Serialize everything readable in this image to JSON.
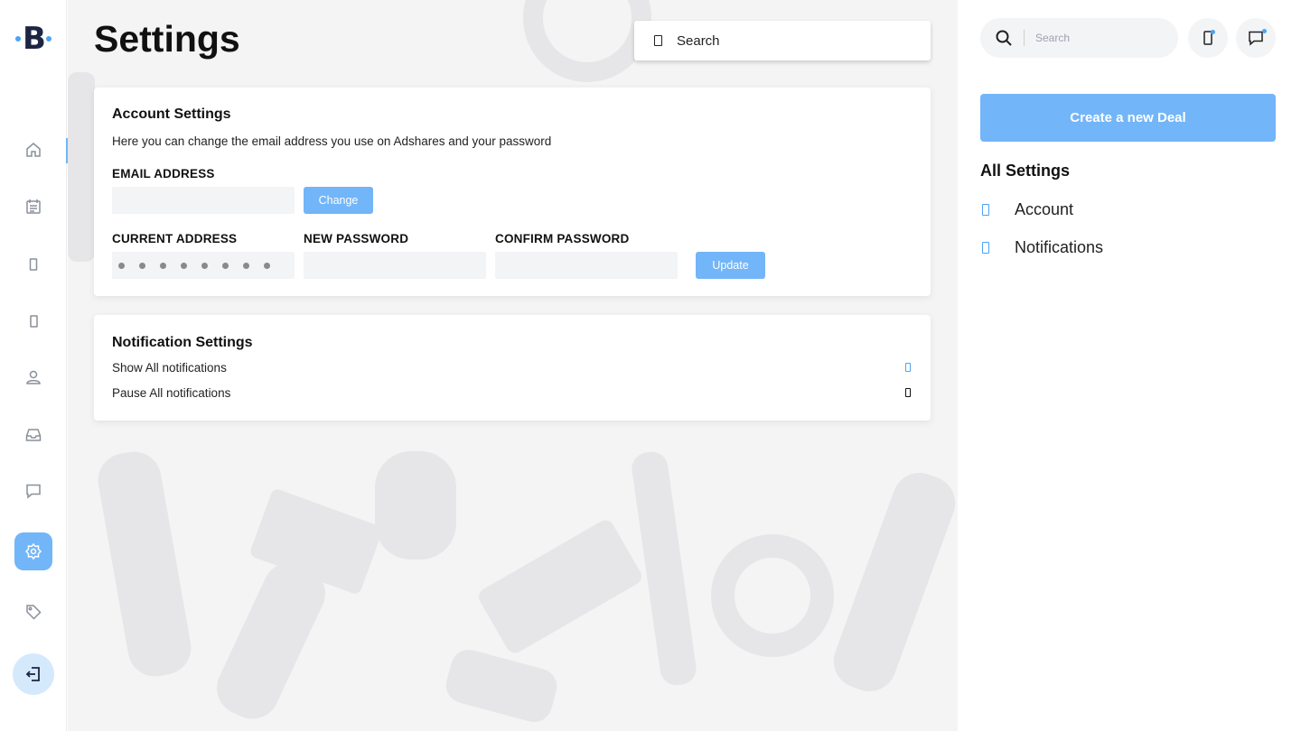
{
  "brand": {
    "logo_letter": "B"
  },
  "left_nav": {
    "items": [
      {
        "icon": "home-icon"
      },
      {
        "icon": "calendar-icon"
      },
      {
        "icon": "document-icon"
      },
      {
        "icon": "document-icon"
      },
      {
        "icon": "user-icon"
      },
      {
        "icon": "inbox-icon"
      },
      {
        "icon": "chat-icon"
      },
      {
        "icon": "settings-gear-icon",
        "active": true
      },
      {
        "icon": "tag-icon"
      },
      {
        "icon": "logout-icon"
      }
    ]
  },
  "header": {
    "title": "Settings",
    "search_label": "Search"
  },
  "account_settings": {
    "title": "Account Settings",
    "description": "Here you can change the email address you use on Adshares and your password",
    "email_label": "EMAIL ADDRESS",
    "email_value": "",
    "change_button": "Change",
    "current_label": "CURRENT ADDRESS",
    "new_password_label": "NEW PASSWORD",
    "confirm_password_label": "CONFIRM PASSWORD",
    "update_button": "Update"
  },
  "notification_settings": {
    "title": "Notification Settings",
    "options": [
      {
        "label": "Show All notifications",
        "checked": true
      },
      {
        "label": "Pause All notifications",
        "checked": false
      }
    ]
  },
  "right_panel": {
    "search_placeholder": "Search",
    "create_deal_button": "Create a new Deal",
    "section_title": "All Settings",
    "links": [
      {
        "label": "Account"
      },
      {
        "label": "Notifications"
      }
    ]
  },
  "colors": {
    "accent": "#72b5f8",
    "accent_light": "#d5e9fd",
    "background": "#f4f4f5",
    "text": "#111111"
  }
}
